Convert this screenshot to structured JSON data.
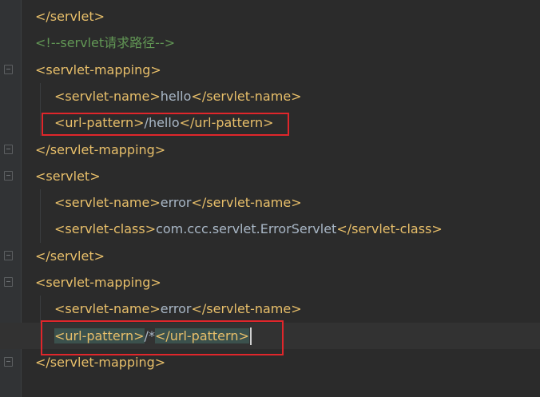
{
  "editor": {
    "lines": [
      {
        "indent": 0,
        "segments": [
          {
            "t": "tag",
            "v": "</servlet>"
          }
        ]
      },
      {
        "indent": 0,
        "segments": [
          {
            "t": "comment",
            "v": "<!--servlet请求路径-->"
          }
        ]
      },
      {
        "indent": 0,
        "segments": [
          {
            "t": "tag",
            "v": "<servlet-mapping>"
          }
        ]
      },
      {
        "indent": 1,
        "segments": [
          {
            "t": "tag",
            "v": "<servlet-name>"
          },
          {
            "t": "txt",
            "v": "hello"
          },
          {
            "t": "tag",
            "v": "</servlet-name>"
          }
        ]
      },
      {
        "indent": 1,
        "segments": [
          {
            "t": "tag",
            "v": "<url-pattern>"
          },
          {
            "t": "txt",
            "v": "/hello"
          },
          {
            "t": "tag",
            "v": "</url-pattern>"
          }
        ]
      },
      {
        "indent": 0,
        "segments": [
          {
            "t": "tag",
            "v": "</servlet-mapping>"
          }
        ]
      },
      {
        "indent": 0,
        "segments": [
          {
            "t": "tag",
            "v": "<servlet>"
          }
        ]
      },
      {
        "indent": 1,
        "segments": [
          {
            "t": "tag",
            "v": "<servlet-name>"
          },
          {
            "t": "txt",
            "v": "error"
          },
          {
            "t": "tag",
            "v": "</servlet-name>"
          }
        ]
      },
      {
        "indent": 1,
        "segments": [
          {
            "t": "tag",
            "v": "<servlet-class>"
          },
          {
            "t": "txt",
            "v": "com.ccc.servlet.ErrorServlet"
          },
          {
            "t": "tag",
            "v": "</servlet-class>"
          }
        ]
      },
      {
        "indent": 0,
        "segments": [
          {
            "t": "tag",
            "v": "</servlet>"
          }
        ]
      },
      {
        "indent": 0,
        "segments": [
          {
            "t": "tag",
            "v": "<servlet-mapping>"
          }
        ]
      },
      {
        "indent": 1,
        "segments": [
          {
            "t": "tag",
            "v": "<servlet-name>"
          },
          {
            "t": "txt",
            "v": "error"
          },
          {
            "t": "tag",
            "v": "</servlet-name>"
          }
        ]
      },
      {
        "indent": 1,
        "current": true,
        "segments": [
          {
            "t": "tag",
            "v": "<url-pattern>",
            "hl": true
          },
          {
            "t": "txt",
            "v": "/*"
          },
          {
            "t": "tag",
            "v": "</url-pattern>",
            "hl": true
          }
        ]
      },
      {
        "indent": 0,
        "segments": [
          {
            "t": "tag",
            "v": "</servlet-mapping>"
          }
        ]
      }
    ]
  },
  "colors": {
    "background": "#2b2b2b",
    "gutter": "#313335",
    "tag": "#e8bf6a",
    "text": "#a9b7c6",
    "comment": "#629755",
    "match_highlight": "#3b514d",
    "annotation_box": "#e0262b"
  },
  "icons": [
    "fold-open-icon",
    "fold-close-icon"
  ]
}
